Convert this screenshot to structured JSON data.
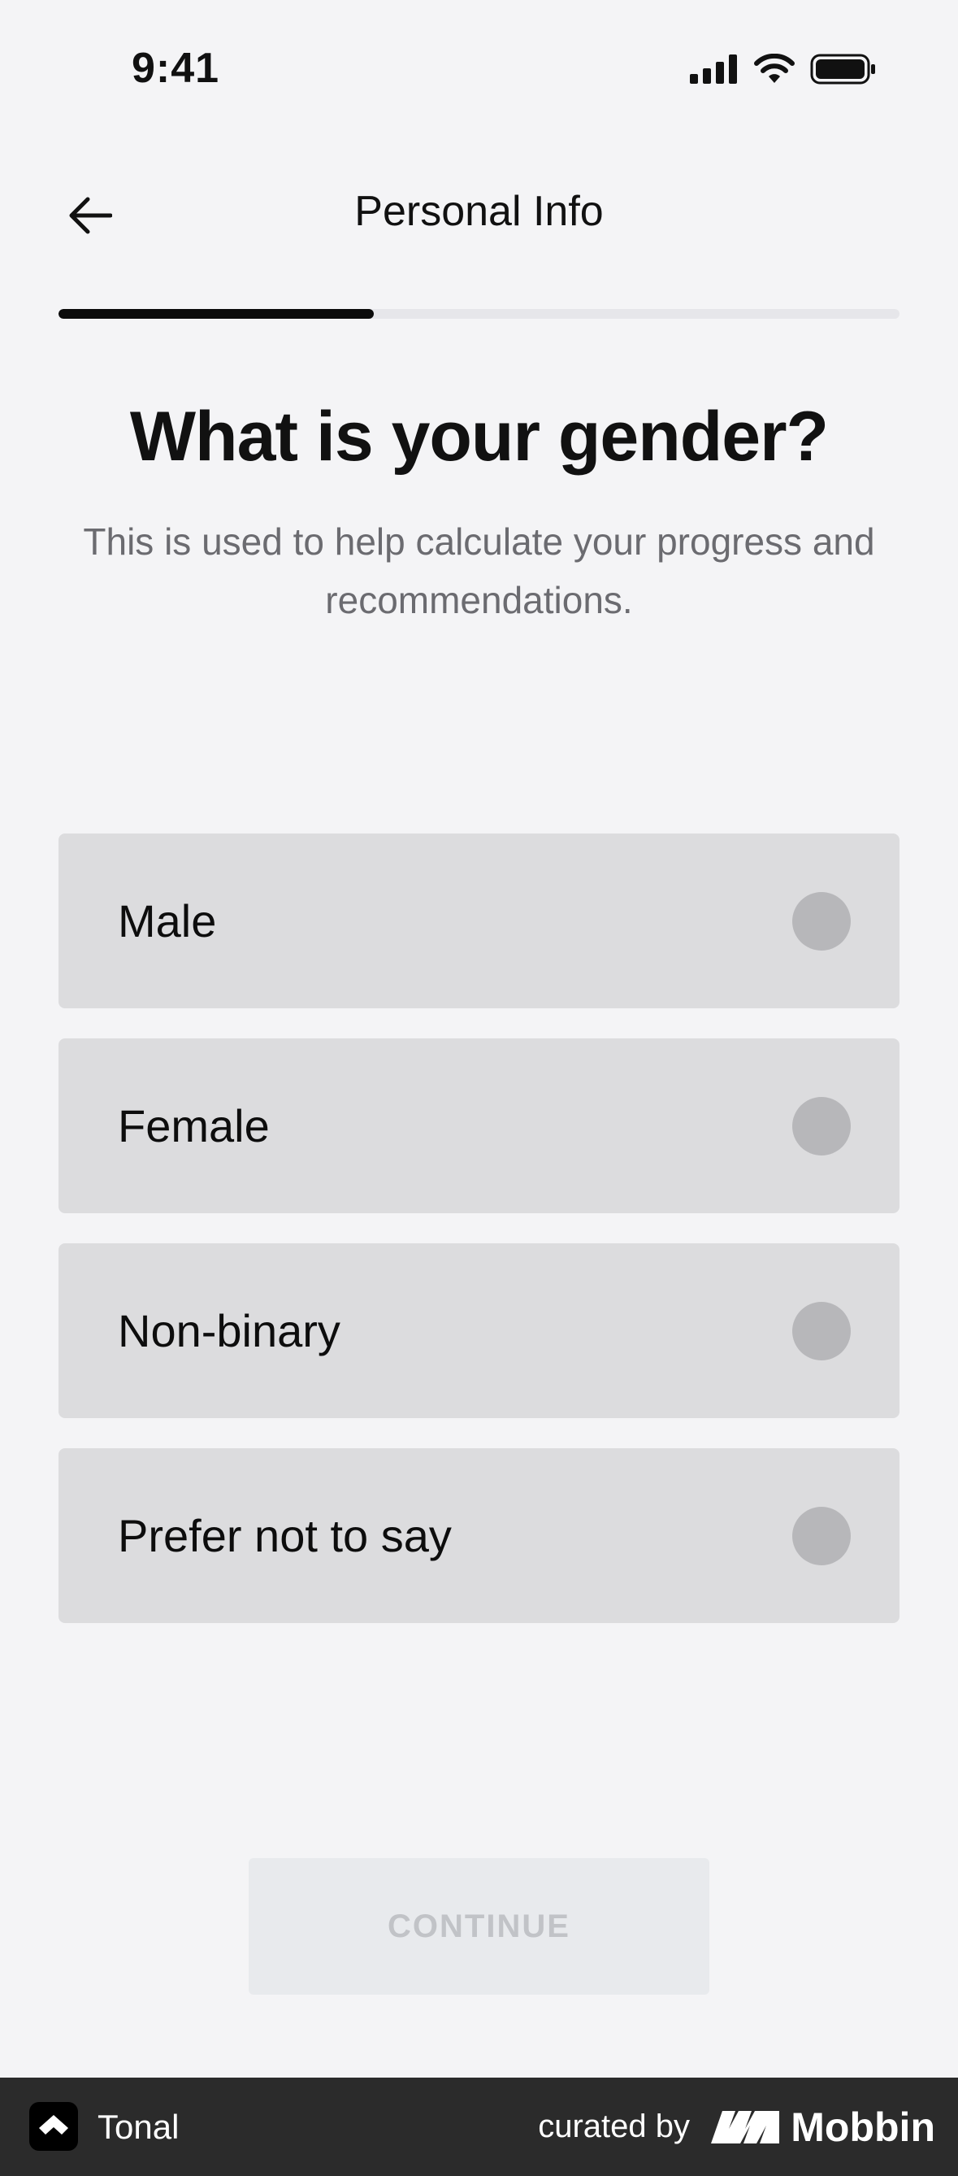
{
  "status_bar": {
    "time": "9:41"
  },
  "header": {
    "title": "Personal Info"
  },
  "progress": {
    "fraction": 0.375
  },
  "question": {
    "title": "What is your gender?",
    "subtitle": "This is used to help calculate your progress and recommendations."
  },
  "options": [
    {
      "label": "Male"
    },
    {
      "label": "Female"
    },
    {
      "label": "Non-binary"
    },
    {
      "label": "Prefer not to say"
    }
  ],
  "continue": {
    "label": "CONTINUE"
  },
  "footer": {
    "app_name": "Tonal",
    "curated_by": "curated by",
    "brand": "Mobbin"
  },
  "colors": {
    "background": "#f4f4f6",
    "option_bg": "#dcdcde",
    "radio": "#b7b7ba",
    "progress_fill": "#0b0b0b",
    "footer_bg": "#2b2b2b"
  }
}
